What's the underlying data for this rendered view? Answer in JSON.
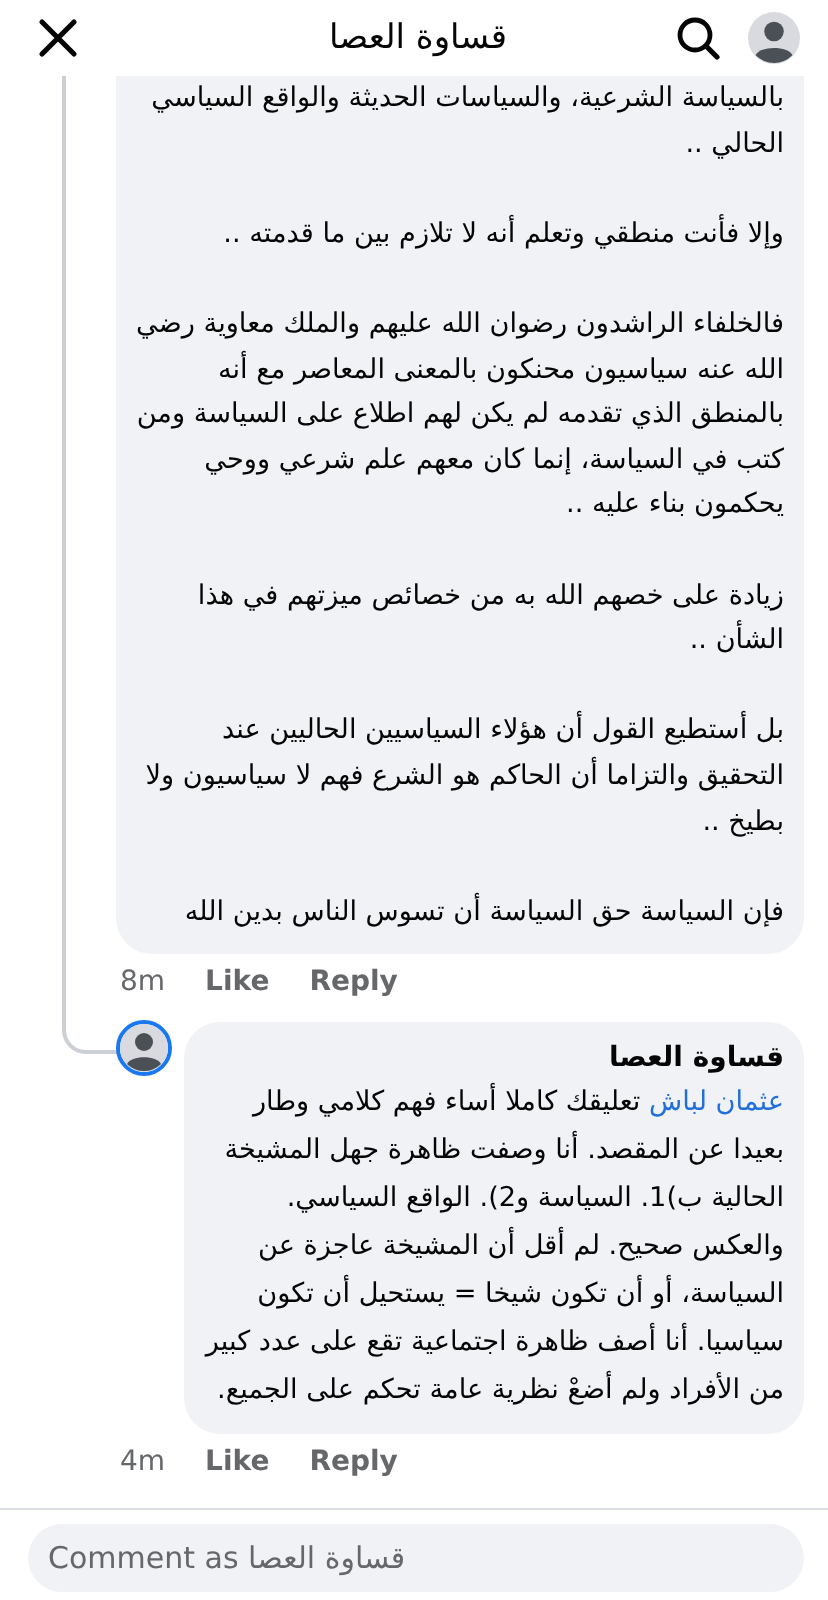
{
  "header": {
    "title": "قساوة العصا"
  },
  "comments": [
    {
      "kind": "parent",
      "paragraphs": [
        "بالسياسة الشرعية، والسياسات الحديثة والواقع السياسي الحالي ..",
        "وإلا فأنت منطقي وتعلم أنه لا تلازم بين ما قدمته ..",
        "فالخلفاء الراشدون رضوان الله عليهم والملك معاوية رضي الله عنه سياسيون محنكون بالمعنى المعاصر مع أنه بالمنطق الذي تقدمه لم يكن لهم اطلاع على السياسة ومن كتب في السياسة، إنما كان معهم علم شرعي ووحي يحكمون بناء عليه ..",
        "زيادة على خصهم الله به من خصائص ميزتهم في هذا الشأن ..",
        "بل أستطيع القول أن هؤلاء السياسيين الحاليين عند التحقيق والتزاما أن الحاكم هو الشرع فهم لا سياسيون ولا بطيخ ..",
        "فإن السياسة حق السياسة أن تسوس الناس بدين الله"
      ],
      "time": "8m",
      "like": "Like",
      "reply": "Reply"
    },
    {
      "kind": "reply",
      "author": "قساوة العصا",
      "mention": "عثمان لباش",
      "paragraphs": [
        "تعليقك كاملا أساء فهم كلامي وطار بعيدا عن المقصد. أنا وصفت ظاهرة جهل المشيخة الحالية ب)1. السياسة و2). الواقع السياسي. والعكس صحيح. لم أقل أن المشيخة عاجزة عن السياسة، أو أن تكون شيخا = يستحيل أن تكون سياسيا. أنا أصف ظاهرة اجتماعية تقع على عدد كبير من الأفراد ولم أضعْ نظرية عامة تحكم على الجميع."
      ],
      "time": "4m",
      "like": "Like",
      "reply": "Reply"
    }
  ],
  "composer": {
    "placeholder": "Comment as قساوة العصا"
  }
}
